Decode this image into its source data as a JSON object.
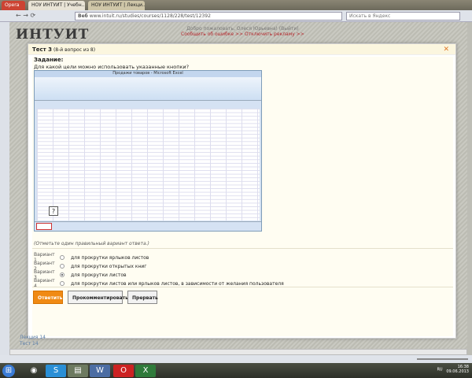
{
  "browser": {
    "menu": "Opera",
    "tabs": [
      "НОУ ИНТУИТ | Учебн...",
      "НОУ ИНТУИТ | Лекци..."
    ],
    "url_badge": "Веб",
    "url": "www.intuit.ru/studies/courses/1128/228/test/12392",
    "search_placeholder": "Искать в Яндекс"
  },
  "site": {
    "logo": "ИНТУИТ",
    "welcome": "Добро пожаловать, Олеся Юрьевна! (Выйти)",
    "links": "Сообщить об ошибке >> Отключить рекламу >>"
  },
  "modal": {
    "title": "Тест 3",
    "subtitle": "(8-й вопрос из 8)",
    "task_label": "Задание:",
    "question": "Для какой цели можно использовать указанные кнопки?",
    "excel_title": "Продажи товаров - Microsoft Excel",
    "callout": "?",
    "instruction": "(Отметьте один правильный вариант ответа.)",
    "options": [
      {
        "label": "Вариант 1",
        "text": "для прокрутки ярлыков листов",
        "selected": false
      },
      {
        "label": "Вариант 2",
        "text": "для прокрутки открытых книг",
        "selected": false
      },
      {
        "label": "Вариант 3",
        "text": "для прокрутки листов",
        "selected": true
      },
      {
        "label": "Вариант 4",
        "text": "для прокрутки листов или ярлыков листов, в зависимости от желания пользователя",
        "selected": false
      }
    ],
    "buttons": {
      "answer": "Ответить",
      "comment": "Прокомментировать",
      "abort": "Прервать"
    }
  },
  "footer_links": [
    "Лекция 14",
    "Тест 14"
  ],
  "tray": {
    "lang": "RU",
    "time": "16:38",
    "date": "09.06.2013"
  }
}
